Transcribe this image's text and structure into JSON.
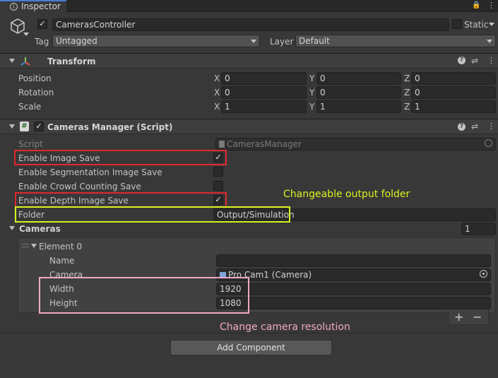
{
  "tab": {
    "title": "Inspector",
    "lock": "🔒",
    "menu": "⋮"
  },
  "object": {
    "name": "CamerasController",
    "static_label": "Static",
    "tag_label": "Tag",
    "tag_value": "Untagged",
    "layer_label": "Layer",
    "layer_value": "Default"
  },
  "transform": {
    "title": "Transform",
    "rows": [
      {
        "label": "Position",
        "x": "0",
        "y": "0",
        "z": "0"
      },
      {
        "label": "Rotation",
        "x": "0",
        "y": "0",
        "z": "0"
      },
      {
        "label": "Scale",
        "x": "1",
        "y": "1",
        "z": "1"
      }
    ],
    "axis": {
      "x": "X",
      "y": "Y",
      "z": "Z"
    }
  },
  "script_component": {
    "title": "Cameras Manager (Script)",
    "script_label": "Script",
    "script_value": "CamerasManager",
    "enable_image_save": {
      "label": "Enable Image Save",
      "checked": true
    },
    "enable_segmentation": {
      "label": "Enable Segmentation Image Save",
      "checked": false
    },
    "enable_crowd": {
      "label": "Enable Crowd Counting Save",
      "checked": false
    },
    "enable_depth": {
      "label": "Enable Depth Image Save",
      "checked": true
    },
    "folder_label": "Folder",
    "folder_value": "Output/Simulation",
    "cameras_label": "Cameras",
    "cameras_count": "1",
    "element": {
      "title": "Element 0",
      "name_label": "Name",
      "name_value": "",
      "camera_label": "Camera",
      "camera_value": "Pro Cam1 (Camera)",
      "width_label": "Width",
      "width_value": "1920",
      "height_label": "Height",
      "height_value": "1080"
    },
    "plus": "+",
    "minus": "−"
  },
  "add_component": "Add Component",
  "annotations": {
    "folder": "Changeable output folder",
    "resolution": "Change camera resolution"
  },
  "colors": {
    "red": "#e0282e",
    "yellow": "#d9f21f",
    "pink": "#f0a8c6"
  }
}
